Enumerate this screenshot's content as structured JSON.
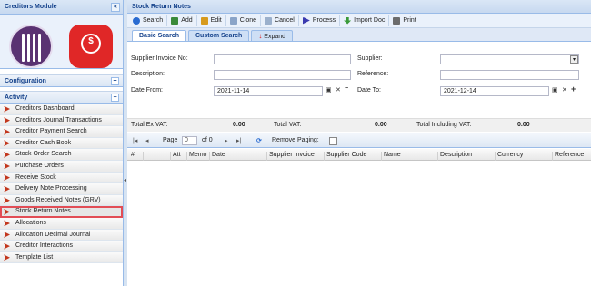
{
  "sidebar": {
    "title": "Creditors Module",
    "collapse_glyph": "«",
    "sections": [
      {
        "label": "Configuration",
        "toggle": "+"
      },
      {
        "label": "Activity",
        "toggle": "−"
      }
    ],
    "items": [
      {
        "label": "Creditors Dashboard"
      },
      {
        "label": "Creditors Journal Transactions"
      },
      {
        "label": "Creditor Payment Search"
      },
      {
        "label": "Creditor Cash Book"
      },
      {
        "label": "Stock Order Search"
      },
      {
        "label": "Purchase Orders"
      },
      {
        "label": "Receive Stock"
      },
      {
        "label": "Delivery Note Processing"
      },
      {
        "label": "Goods Received Notes (GRV)"
      },
      {
        "label": "Stock Return Notes"
      },
      {
        "label": "Allocations"
      },
      {
        "label": "Allocation Decimal Journal"
      },
      {
        "label": "Creditor Interactions"
      },
      {
        "label": "Template List"
      }
    ]
  },
  "main": {
    "title": "Stock Return Notes",
    "toolbar": [
      {
        "label": "Search",
        "icon": "search-icon",
        "color": "#2a6bd1"
      },
      {
        "label": "Add",
        "icon": "add-icon",
        "color": "#3a8a3a"
      },
      {
        "label": "Edit",
        "icon": "edit-icon",
        "color": "#d79a1d"
      },
      {
        "label": "Clone",
        "icon": "clone-icon",
        "color": "#8aa4c8"
      },
      {
        "label": "Cancel",
        "icon": "cancel-icon",
        "color": "#9bb0cc"
      },
      {
        "label": "Process",
        "icon": "process-icon",
        "color": "#3b3bb0"
      },
      {
        "label": "Import Doc",
        "icon": "import-icon",
        "color": "#3a9a3a"
      },
      {
        "label": "Print",
        "icon": "print-icon",
        "color": "#6c6c6c"
      }
    ],
    "tabs": {
      "basic": "Basic Search",
      "custom": "Custom Search",
      "expand": "Expand"
    },
    "form": {
      "supplier_invoice_label": "Supplier Invoice No:",
      "supplier_invoice_value": "",
      "supplier_label": "Supplier:",
      "supplier_value": "",
      "description_label": "Description:",
      "description_value": "",
      "reference_label": "Reference:",
      "reference_value": "",
      "date_from_label": "Date From:",
      "date_from_value": "2021-11-14",
      "date_to_label": "Date To:",
      "date_to_value": "2021-12-14"
    },
    "totals": {
      "ex_vat_label": "Total Ex VAT:",
      "ex_vat_value": "0.00",
      "vat_label": "Total VAT:",
      "vat_value": "0.00",
      "incl_vat_label": "Total Including VAT:",
      "incl_vat_value": "0.00"
    },
    "pager": {
      "page_label": "Page",
      "page_value": "0",
      "of_label": "of 0",
      "remove_paging_label": "Remove Paging:"
    },
    "grid_columns": [
      "#",
      "Att",
      "Memo",
      "Date",
      "Supplier Invoice",
      "Supplier Code",
      "Name",
      "Description",
      "Currency",
      "Reference"
    ]
  }
}
